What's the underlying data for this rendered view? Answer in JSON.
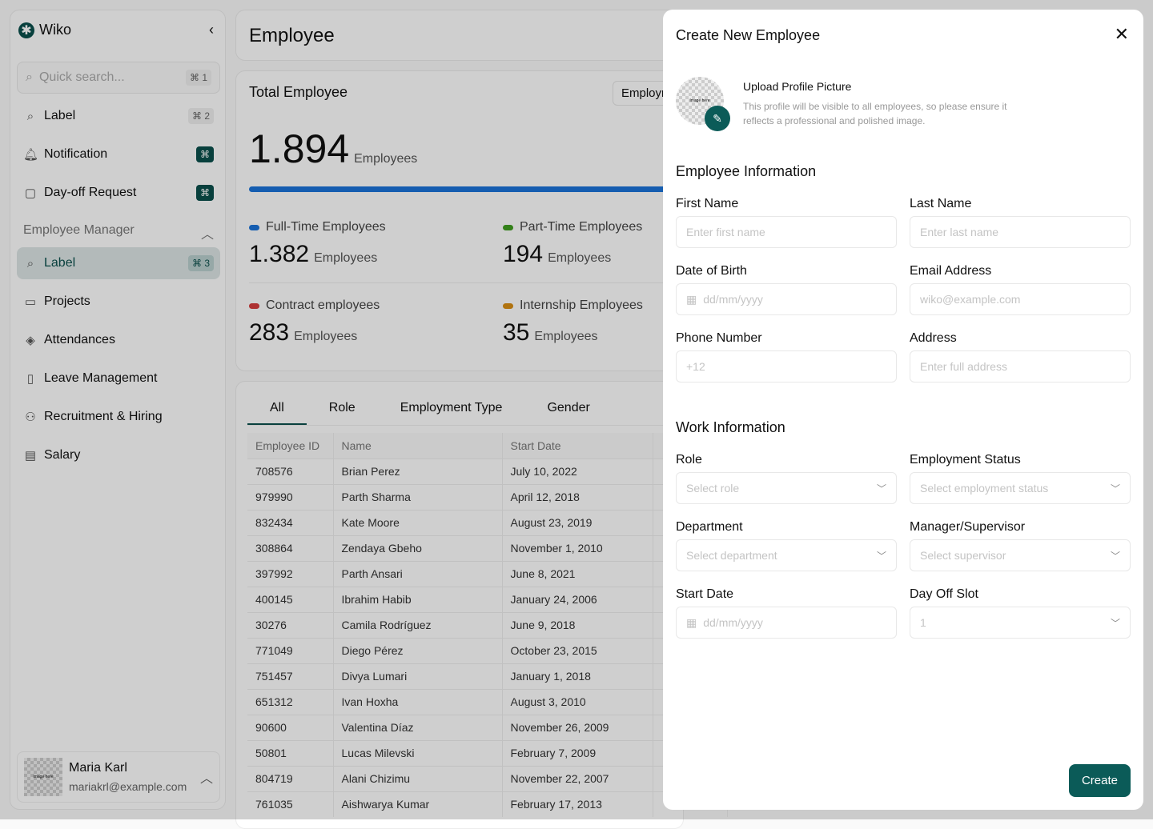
{
  "sidebar": {
    "brand": "Wiko",
    "search_placeholder": "Quick search...",
    "search_kbd": "⌘ 1",
    "items": [
      {
        "label": "Label",
        "icon": "search-icon",
        "kbd": "⌘ 2"
      },
      {
        "label": "Notification",
        "icon": "bell-icon",
        "kbd": "⌘"
      },
      {
        "label": "Day-off Request",
        "icon": "bag-icon",
        "kbd": "⌘"
      }
    ],
    "section": "Employee Manager",
    "section_items": [
      {
        "label": "Label",
        "icon": "search-icon",
        "kbd": "⌘ 3",
        "active": true
      },
      {
        "label": "Projects",
        "icon": "folder-icon"
      },
      {
        "label": "Attendances",
        "icon": "layers-icon"
      },
      {
        "label": "Leave Management",
        "icon": "file-icon"
      },
      {
        "label": "Recruitment & Hiring",
        "icon": "user-plus-icon"
      },
      {
        "label": "Salary",
        "icon": "receipt-icon"
      }
    ],
    "user": {
      "name": "Maria Karl",
      "email": "mariakrl@example.com",
      "avatar_text": "Image here"
    }
  },
  "header": {
    "title": "Employee"
  },
  "stats": {
    "title": "Total Employee",
    "filter": "Employment Type",
    "total": "1.894",
    "unit": "Employees",
    "breakdown": [
      {
        "label": "Full-Time Employees",
        "value": "1.382",
        "color": "#1a73d9",
        "count": 1382
      },
      {
        "label": "Part-Time Employees",
        "value": "194",
        "color": "#3f9e1f",
        "count": 194
      },
      {
        "label": "Contract employees",
        "value": "283",
        "color": "#d63d3d",
        "count": 283
      },
      {
        "label": "Internship Employees",
        "value": "35",
        "color": "#d98e14",
        "count": 35
      }
    ]
  },
  "table": {
    "tabs": [
      "All",
      "Role",
      "Employment Type",
      "Gender"
    ],
    "columns": [
      "Employee ID",
      "Name",
      "Start Date"
    ],
    "rows": [
      [
        "708576",
        "Brian Perez",
        "July 10, 2022"
      ],
      [
        "979990",
        "Parth Sharma",
        "April 12, 2018"
      ],
      [
        "832434",
        "Kate Moore",
        "August 23, 2019"
      ],
      [
        "308864",
        "Zendaya Gbeho",
        "November 1, 2010"
      ],
      [
        "397992",
        "Parth Ansari",
        "June 8, 2021"
      ],
      [
        "400145",
        "Ibrahim Habib",
        "January 24, 2006"
      ],
      [
        "30276",
        "Camila Rodríguez",
        "June 9, 2018"
      ],
      [
        "771049",
        "Diego Pérez",
        "October 23, 2015"
      ],
      [
        "751457",
        "Divya Lumari",
        "January 1, 2018"
      ],
      [
        "651312",
        "Ivan Hoxha",
        "August 3, 2010"
      ],
      [
        "90600",
        "Valentina Díaz",
        "November 26, 2009"
      ],
      [
        "50801",
        "Lucas Milevski",
        "February 7, 2009"
      ],
      [
        "804719",
        "Alani Chizimu",
        "November 22, 2007"
      ],
      [
        "761035",
        "Aishwarya Kumar",
        "February 17, 2013"
      ]
    ]
  },
  "modal": {
    "title": "Create New Employee",
    "upload_title": "Upload Profile Picture",
    "upload_desc": "This profile will be visible to all employees, so please ensure it reflects a professional and polished image.",
    "pic_text": "Image here",
    "employee_section": "Employee Information",
    "work_section": "Work Information",
    "fields": [
      {
        "label": "First Name",
        "placeholder": "Enter first name"
      },
      {
        "label": "Last Name",
        "placeholder": "Enter last name"
      },
      {
        "label": "Date of Birth",
        "placeholder": "dd/mm/yyyy"
      },
      {
        "label": "Email Address",
        "placeholder": "wiko@example.com"
      },
      {
        "label": "Phone Number",
        "placeholder": "+12"
      },
      {
        "label": "Address",
        "placeholder": "Enter full address"
      }
    ],
    "work_fields": [
      {
        "label": "Role",
        "placeholder": "Select role"
      },
      {
        "label": "Employment Status",
        "placeholder": "Select employment status"
      },
      {
        "label": "Department",
        "placeholder": "Select department"
      },
      {
        "label": "Manager/Supervisor",
        "placeholder": "Select supervisor"
      },
      {
        "label": "Start Date",
        "placeholder": "dd/mm/yyyy"
      },
      {
        "label": "Day Off Slot",
        "placeholder": "1"
      }
    ],
    "create_label": "Create"
  },
  "colors": {
    "accent": "#0b5b58"
  }
}
